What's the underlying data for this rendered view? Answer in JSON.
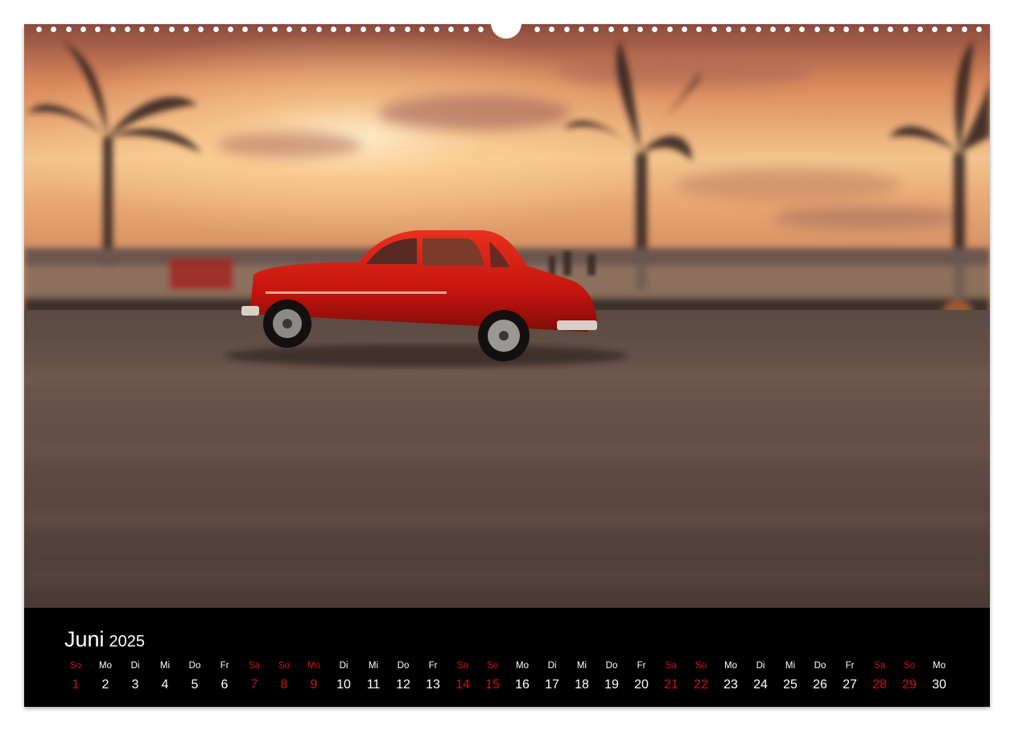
{
  "calendar": {
    "month": "Juni",
    "year": "2025",
    "weekend_color": "#d0121b",
    "days": [
      {
        "wd": "So",
        "d": "1",
        "red": true
      },
      {
        "wd": "Mo",
        "d": "2",
        "red": false
      },
      {
        "wd": "Di",
        "d": "3",
        "red": false
      },
      {
        "wd": "Mi",
        "d": "4",
        "red": false
      },
      {
        "wd": "Do",
        "d": "5",
        "red": false
      },
      {
        "wd": "Fr",
        "d": "6",
        "red": false
      },
      {
        "wd": "Sa",
        "d": "7",
        "red": true
      },
      {
        "wd": "So",
        "d": "8",
        "red": true
      },
      {
        "wd": "Mo",
        "d": "9",
        "red": true
      },
      {
        "wd": "Di",
        "d": "10",
        "red": false
      },
      {
        "wd": "Mi",
        "d": "11",
        "red": false
      },
      {
        "wd": "Do",
        "d": "12",
        "red": false
      },
      {
        "wd": "Fr",
        "d": "13",
        "red": false
      },
      {
        "wd": "Sa",
        "d": "14",
        "red": true
      },
      {
        "wd": "So",
        "d": "15",
        "red": true
      },
      {
        "wd": "Mo",
        "d": "16",
        "red": false
      },
      {
        "wd": "Di",
        "d": "17",
        "red": false
      },
      {
        "wd": "Mi",
        "d": "18",
        "red": false
      },
      {
        "wd": "Do",
        "d": "19",
        "red": false
      },
      {
        "wd": "Fr",
        "d": "20",
        "red": false
      },
      {
        "wd": "Sa",
        "d": "21",
        "red": true
      },
      {
        "wd": "So",
        "d": "22",
        "red": true
      },
      {
        "wd": "Mo",
        "d": "23",
        "red": false
      },
      {
        "wd": "Di",
        "d": "24",
        "red": false
      },
      {
        "wd": "Mi",
        "d": "25",
        "red": false
      },
      {
        "wd": "Do",
        "d": "26",
        "red": false
      },
      {
        "wd": "Fr",
        "d": "27",
        "red": false
      },
      {
        "wd": "Sa",
        "d": "28",
        "red": true
      },
      {
        "wd": "So",
        "d": "29",
        "red": true
      },
      {
        "wd": "Mo",
        "d": "30",
        "red": false
      }
    ]
  },
  "photo": {
    "sky_colors": [
      "#f6c690",
      "#e89a62",
      "#c8603a"
    ],
    "car_color": "#d31a12"
  }
}
